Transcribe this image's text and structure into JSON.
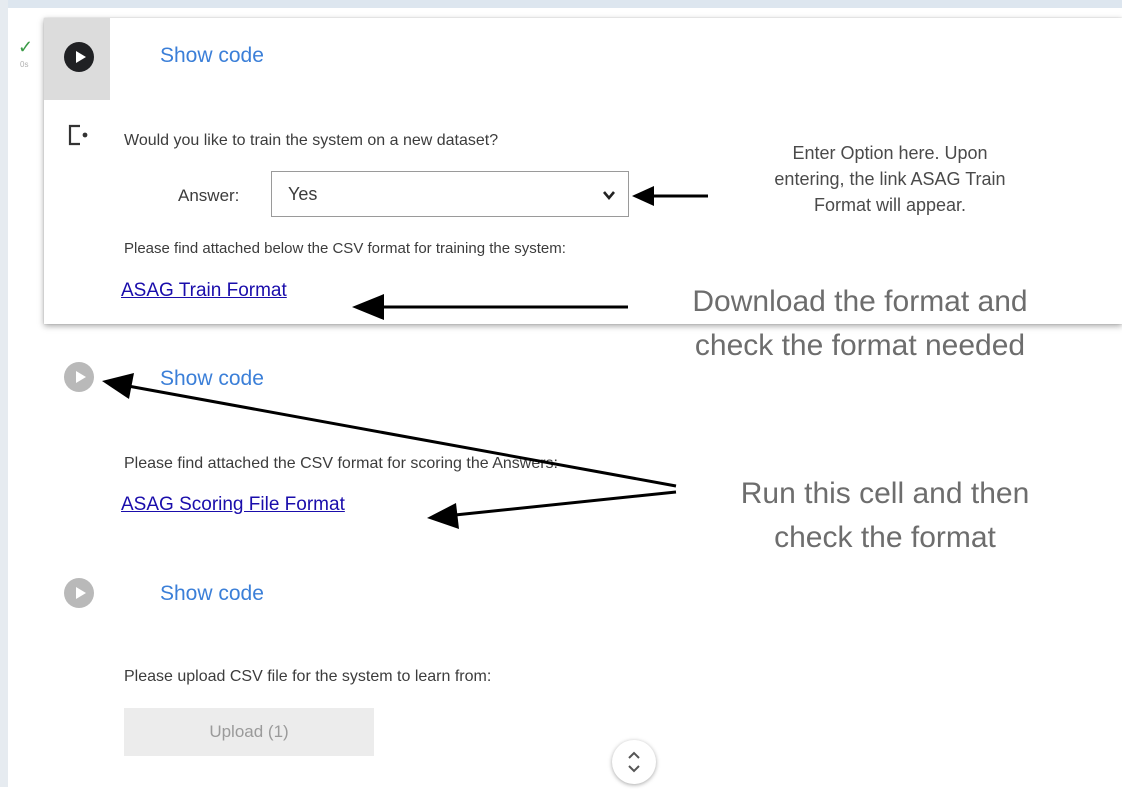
{
  "status": {
    "check_glyph": "✓",
    "check_sub": "0s"
  },
  "cells": [
    {
      "show_code_label": "Show code"
    },
    {
      "show_code_label": "Show code"
    },
    {
      "show_code_label": "Show code"
    }
  ],
  "cell1": {
    "question": "Would you like to train the system on a new dataset?",
    "answer_label": "Answer:",
    "answer_value": "Yes",
    "note": "Please find attached below the CSV format for training the system:",
    "link": "ASAG Train Format"
  },
  "cell2": {
    "note": "Please find attached the CSV format for scoring the Answers:",
    "link": "ASAG Scoring File Format"
  },
  "cell3": {
    "note": "Please upload CSV file for the system to learn from:",
    "upload_label": "Upload (1)"
  },
  "annotations": {
    "select_hint": [
      "Enter Option here. Upon",
      "entering, the link ASAG Train",
      "Format will appear."
    ],
    "download_hint": [
      "Download the format and",
      "check the format needed"
    ],
    "run_hint": [
      "Run this cell and then",
      "check the format"
    ]
  },
  "colors": {
    "link": "#1a0dab",
    "show_code": "#3b7fd8",
    "check": "#3b9b47"
  },
  "icons": [
    "run-cell-icon",
    "output-icon",
    "chevron-down-icon",
    "scroll-icon",
    "check-icon"
  ]
}
